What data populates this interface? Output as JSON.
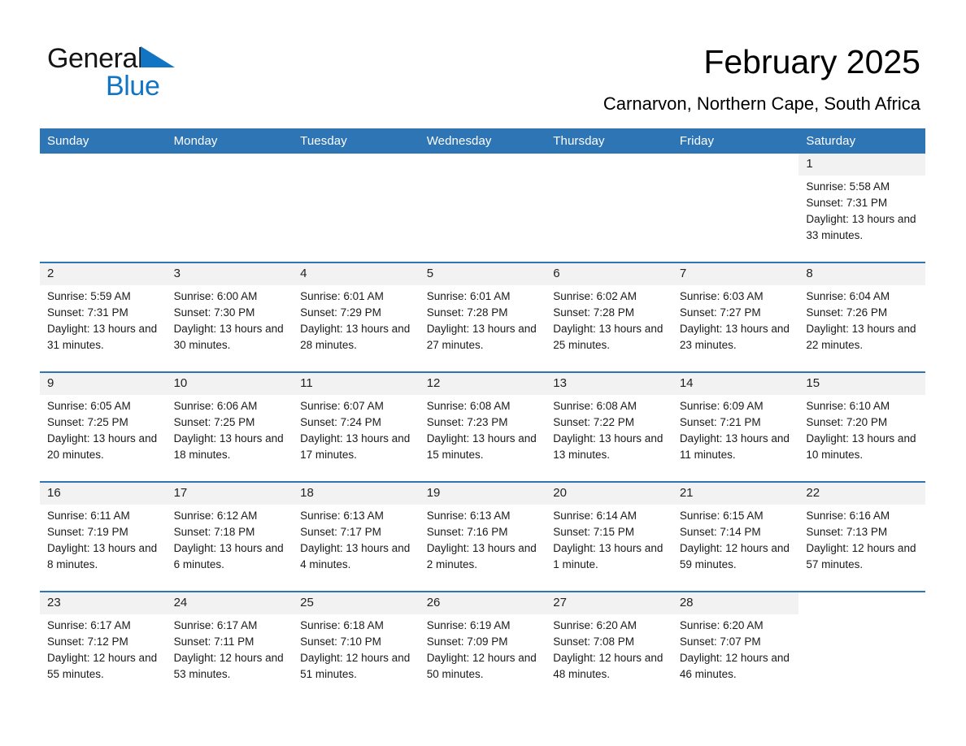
{
  "brand": {
    "name_part1": "General",
    "name_part2": "Blue",
    "triangle_color": "#1275c4",
    "text_color": "#151515"
  },
  "header": {
    "title": "February 2025",
    "subtitle": "Carnarvon, Northern Cape, South Africa"
  },
  "theme": {
    "header_blue": "#2E75B6",
    "daynum_gray": "#F2F2F2",
    "page_background": "#FFFFFF"
  },
  "weekdays": [
    "Sunday",
    "Monday",
    "Tuesday",
    "Wednesday",
    "Thursday",
    "Friday",
    "Saturday"
  ],
  "labels": {
    "sunrise_prefix": "Sunrise:",
    "sunset_prefix": "Sunset:",
    "daylight_prefix": "Daylight:"
  },
  "weeks": [
    [
      {
        "blank": true
      },
      {
        "blank": true
      },
      {
        "blank": true
      },
      {
        "blank": true
      },
      {
        "blank": true
      },
      {
        "blank": true
      },
      {
        "day": "1",
        "sunrise": "Sunrise: 5:58 AM",
        "sunset": "Sunset: 7:31 PM",
        "daylight": "Daylight: 13 hours and 33 minutes."
      }
    ],
    [
      {
        "day": "2",
        "sunrise": "Sunrise: 5:59 AM",
        "sunset": "Sunset: 7:31 PM",
        "daylight": "Daylight: 13 hours and 31 minutes."
      },
      {
        "day": "3",
        "sunrise": "Sunrise: 6:00 AM",
        "sunset": "Sunset: 7:30 PM",
        "daylight": "Daylight: 13 hours and 30 minutes."
      },
      {
        "day": "4",
        "sunrise": "Sunrise: 6:01 AM",
        "sunset": "Sunset: 7:29 PM",
        "daylight": "Daylight: 13 hours and 28 minutes."
      },
      {
        "day": "5",
        "sunrise": "Sunrise: 6:01 AM",
        "sunset": "Sunset: 7:28 PM",
        "daylight": "Daylight: 13 hours and 27 minutes."
      },
      {
        "day": "6",
        "sunrise": "Sunrise: 6:02 AM",
        "sunset": "Sunset: 7:28 PM",
        "daylight": "Daylight: 13 hours and 25 minutes."
      },
      {
        "day": "7",
        "sunrise": "Sunrise: 6:03 AM",
        "sunset": "Sunset: 7:27 PM",
        "daylight": "Daylight: 13 hours and 23 minutes."
      },
      {
        "day": "8",
        "sunrise": "Sunrise: 6:04 AM",
        "sunset": "Sunset: 7:26 PM",
        "daylight": "Daylight: 13 hours and 22 minutes."
      }
    ],
    [
      {
        "day": "9",
        "sunrise": "Sunrise: 6:05 AM",
        "sunset": "Sunset: 7:25 PM",
        "daylight": "Daylight: 13 hours and 20 minutes."
      },
      {
        "day": "10",
        "sunrise": "Sunrise: 6:06 AM",
        "sunset": "Sunset: 7:25 PM",
        "daylight": "Daylight: 13 hours and 18 minutes."
      },
      {
        "day": "11",
        "sunrise": "Sunrise: 6:07 AM",
        "sunset": "Sunset: 7:24 PM",
        "daylight": "Daylight: 13 hours and 17 minutes."
      },
      {
        "day": "12",
        "sunrise": "Sunrise: 6:08 AM",
        "sunset": "Sunset: 7:23 PM",
        "daylight": "Daylight: 13 hours and 15 minutes."
      },
      {
        "day": "13",
        "sunrise": "Sunrise: 6:08 AM",
        "sunset": "Sunset: 7:22 PM",
        "daylight": "Daylight: 13 hours and 13 minutes."
      },
      {
        "day": "14",
        "sunrise": "Sunrise: 6:09 AM",
        "sunset": "Sunset: 7:21 PM",
        "daylight": "Daylight: 13 hours and 11 minutes."
      },
      {
        "day": "15",
        "sunrise": "Sunrise: 6:10 AM",
        "sunset": "Sunset: 7:20 PM",
        "daylight": "Daylight: 13 hours and 10 minutes."
      }
    ],
    [
      {
        "day": "16",
        "sunrise": "Sunrise: 6:11 AM",
        "sunset": "Sunset: 7:19 PM",
        "daylight": "Daylight: 13 hours and 8 minutes."
      },
      {
        "day": "17",
        "sunrise": "Sunrise: 6:12 AM",
        "sunset": "Sunset: 7:18 PM",
        "daylight": "Daylight: 13 hours and 6 minutes."
      },
      {
        "day": "18",
        "sunrise": "Sunrise: 6:13 AM",
        "sunset": "Sunset: 7:17 PM",
        "daylight": "Daylight: 13 hours and 4 minutes."
      },
      {
        "day": "19",
        "sunrise": "Sunrise: 6:13 AM",
        "sunset": "Sunset: 7:16 PM",
        "daylight": "Daylight: 13 hours and 2 minutes."
      },
      {
        "day": "20",
        "sunrise": "Sunrise: 6:14 AM",
        "sunset": "Sunset: 7:15 PM",
        "daylight": "Daylight: 13 hours and 1 minute."
      },
      {
        "day": "21",
        "sunrise": "Sunrise: 6:15 AM",
        "sunset": "Sunset: 7:14 PM",
        "daylight": "Daylight: 12 hours and 59 minutes."
      },
      {
        "day": "22",
        "sunrise": "Sunrise: 6:16 AM",
        "sunset": "Sunset: 7:13 PM",
        "daylight": "Daylight: 12 hours and 57 minutes."
      }
    ],
    [
      {
        "day": "23",
        "sunrise": "Sunrise: 6:17 AM",
        "sunset": "Sunset: 7:12 PM",
        "daylight": "Daylight: 12 hours and 55 minutes."
      },
      {
        "day": "24",
        "sunrise": "Sunrise: 6:17 AM",
        "sunset": "Sunset: 7:11 PM",
        "daylight": "Daylight: 12 hours and 53 minutes."
      },
      {
        "day": "25",
        "sunrise": "Sunrise: 6:18 AM",
        "sunset": "Sunset: 7:10 PM",
        "daylight": "Daylight: 12 hours and 51 minutes."
      },
      {
        "day": "26",
        "sunrise": "Sunrise: 6:19 AM",
        "sunset": "Sunset: 7:09 PM",
        "daylight": "Daylight: 12 hours and 50 minutes."
      },
      {
        "day": "27",
        "sunrise": "Sunrise: 6:20 AM",
        "sunset": "Sunset: 7:08 PM",
        "daylight": "Daylight: 12 hours and 48 minutes."
      },
      {
        "day": "28",
        "sunrise": "Sunrise: 6:20 AM",
        "sunset": "Sunset: 7:07 PM",
        "daylight": "Daylight: 12 hours and 46 minutes."
      },
      {
        "blank": true
      }
    ]
  ]
}
